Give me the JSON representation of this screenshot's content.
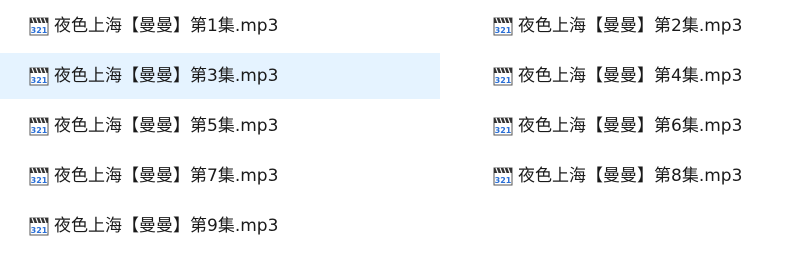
{
  "files": [
    {
      "name": "夜色上海【曼曼】第1集.mp3",
      "icon": "media-file-icon",
      "selected": false
    },
    {
      "name": "夜色上海【曼曼】第2集.mp3",
      "icon": "media-file-icon",
      "selected": false
    },
    {
      "name": "夜色上海【曼曼】第3集.mp3",
      "icon": "media-file-icon",
      "selected": true
    },
    {
      "name": "夜色上海【曼曼】第4集.mp3",
      "icon": "media-file-icon",
      "selected": false
    },
    {
      "name": "夜色上海【曼曼】第5集.mp3",
      "icon": "media-file-icon",
      "selected": false
    },
    {
      "name": "夜色上海【曼曼】第6集.mp3",
      "icon": "media-file-icon",
      "selected": false
    },
    {
      "name": "夜色上海【曼曼】第7集.mp3",
      "icon": "media-file-icon",
      "selected": false
    },
    {
      "name": "夜色上海【曼曼】第8集.mp3",
      "icon": "media-file-icon",
      "selected": false
    },
    {
      "name": "夜色上海【曼曼】第9集.mp3",
      "icon": "media-file-icon",
      "selected": false
    }
  ],
  "colors": {
    "selection": "#e5f3ff",
    "text": "#1a1a1a"
  }
}
